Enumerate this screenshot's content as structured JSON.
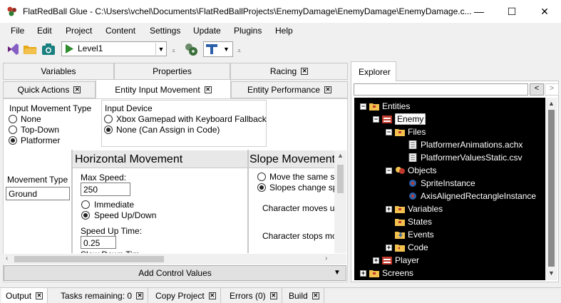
{
  "window": {
    "title": "FlatRedBall Glue - C:\\Users\\vchel\\Documents\\FlatRedBallProjects\\EnemyDamage\\EnemyDamage\\EnemyDamage.c...",
    "minimize": "—",
    "maximize": "☐",
    "close": "✕"
  },
  "menu": [
    "File",
    "Edit",
    "Project",
    "Content",
    "Settings",
    "Update",
    "Plugins",
    "Help"
  ],
  "toolbar": {
    "level": "Level1"
  },
  "tabs_row1": [
    {
      "label": "Variables",
      "closable": false
    },
    {
      "label": "Properties",
      "closable": false
    },
    {
      "label": "Racing",
      "closable": true
    }
  ],
  "tabs_row2": [
    {
      "label": "Quick Actions",
      "closable": true
    },
    {
      "label": "Entity Input Movement",
      "closable": true,
      "active": true
    },
    {
      "label": "Entity Performance",
      "closable": true
    }
  ],
  "input_movement": {
    "title": "Input Movement Type",
    "options": [
      "None",
      "Top-Down",
      "Platformer"
    ],
    "selected": 2
  },
  "input_device": {
    "title": "Input Device",
    "options": [
      "Xbox Gamepad with Keyboard Fallback",
      "None (Can Assign in Code)"
    ],
    "selected": 1
  },
  "movement_type": {
    "label": "Movement Type",
    "value": "Ground"
  },
  "horizontal": {
    "header": "Horizontal Movement",
    "max_speed_label": "Max Speed:",
    "max_speed_value": "250",
    "immediate": "Immediate",
    "speed_up_down": "Speed Up/Down",
    "speed_up_time_label": "Speed Up Time:",
    "speed_up_time_value": "0.25",
    "slow_down_time_label": "Slow Down Tim"
  },
  "slope": {
    "header": "Slope Movement",
    "opt1": "Move the same s",
    "opt2": "Slopes change sp",
    "text1": "Character moves u",
    "text2": "Character stops mo"
  },
  "add_control_values": "Add Control Values",
  "explorer": {
    "tab": "Explorer",
    "nav_left": "<",
    "nav_right": ">",
    "tree": [
      {
        "label": "Entities",
        "toggle": "−",
        "icon": "folder-icon"
      },
      {
        "label": "Enemy",
        "toggle": "−",
        "icon": "entity-icon",
        "selected": true
      },
      {
        "label": "Files",
        "toggle": "−",
        "icon": "folder-icon"
      },
      {
        "label": "PlatformerAnimations.achx",
        "toggle": "",
        "icon": "file-icon"
      },
      {
        "label": "PlatformerValuesStatic.csv",
        "toggle": "",
        "icon": "file-icon"
      },
      {
        "label": "Objects",
        "toggle": "−",
        "icon": "objects-icon"
      },
      {
        "label": "SpriteInstance",
        "toggle": "",
        "icon": "object-icon"
      },
      {
        "label": "AxisAlignedRectangleInstance",
        "toggle": "",
        "icon": "object-icon"
      },
      {
        "label": "Variables",
        "toggle": "+",
        "icon": "folder-icon"
      },
      {
        "label": "States",
        "toggle": "",
        "icon": "folder-icon"
      },
      {
        "label": "Events",
        "toggle": "",
        "icon": "events-icon"
      },
      {
        "label": "Code",
        "toggle": "+",
        "icon": "code-icon"
      },
      {
        "label": "Player",
        "toggle": "+",
        "icon": "entity-icon"
      },
      {
        "label": "Screens",
        "toggle": "+",
        "icon": "folder-icon"
      }
    ]
  },
  "bottom_tabs": [
    {
      "label": "Output"
    },
    {
      "label": "Tasks remaining: 0"
    },
    {
      "label": "Copy Project"
    },
    {
      "label": "Errors (0)"
    },
    {
      "label": "Build"
    }
  ],
  "colors": {
    "accent_red": "#c0392b",
    "folder": "#f2c14e",
    "tree_bg": "#000000"
  }
}
